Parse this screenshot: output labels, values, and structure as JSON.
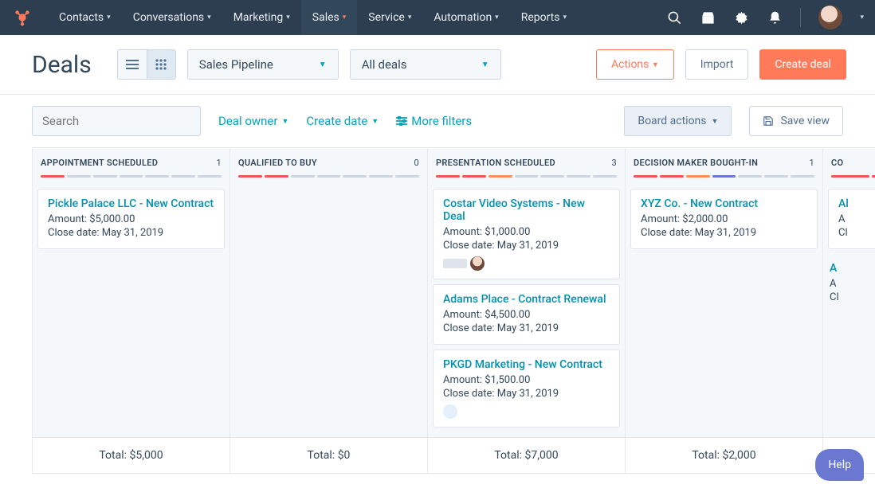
{
  "nav": {
    "items": [
      {
        "label": "Contacts"
      },
      {
        "label": "Conversations"
      },
      {
        "label": "Marketing"
      },
      {
        "label": "Sales",
        "active": true
      },
      {
        "label": "Service"
      },
      {
        "label": "Automation"
      },
      {
        "label": "Reports"
      }
    ]
  },
  "header": {
    "title": "Deals",
    "pipeline": "Sales Pipeline",
    "deals_filter": "All deals",
    "actions": "Actions",
    "import": "Import",
    "create": "Create deal"
  },
  "filters": {
    "search_placeholder": "Search",
    "deal_owner": "Deal owner",
    "create_date": "Create date",
    "more_filters": "More filters",
    "board_actions": "Board actions",
    "save_view": "Save view"
  },
  "columns": [
    {
      "title": "APPOINTMENT SCHEDULED",
      "count": "1",
      "cards": [
        {
          "title": "Pickle Palace LLC - New Contract",
          "amount_label": "Amount:",
          "amount": "$5,000.00",
          "close_label": "Close date:",
          "close": "May 31, 2019"
        }
      ],
      "total_label": "Total:",
      "total": "$5,000"
    },
    {
      "title": "QUALIFIED TO BUY",
      "count": "0",
      "cards": [],
      "total_label": "Total:",
      "total": "$0"
    },
    {
      "title": "PRESENTATION SCHEDULED",
      "count": "3",
      "cards": [
        {
          "title": "Costar Video Systems - New Deal",
          "amount_label": "Amount:",
          "amount": "$1,000.00",
          "close_label": "Close date:",
          "close": "May 31, 2019",
          "avatars": true
        },
        {
          "title": "Adams Place - Contract Renewal",
          "amount_label": "Amount:",
          "amount": "$4,500.00",
          "close_label": "Close date:",
          "close": "May 31, 2019"
        },
        {
          "title": "PKGD Marketing - New Contract",
          "amount_label": "Amount:",
          "amount": "$1,500.00",
          "close_label": "Close date:",
          "close": "May 31, 2019",
          "oneav": true
        }
      ],
      "total_label": "Total:",
      "total": "$7,000"
    },
    {
      "title": "DECISION MAKER BOUGHT-IN",
      "count": "1",
      "cards": [
        {
          "title": "XYZ Co. - New Contract",
          "amount_label": "Amount:",
          "amount": "$2,000.00",
          "close_label": "Close date:",
          "close": "May 31, 2019"
        }
      ],
      "total_label": "Total:",
      "total": "$2,000"
    },
    {
      "title": "CO",
      "count": "",
      "cards": [
        {
          "title": "Al",
          "amount_label": "A",
          "amount": "",
          "close_label": "Cl",
          "close": ""
        },
        {
          "title": "A",
          "amount_label": "A",
          "amount": "",
          "close_label": "Cl",
          "close": ""
        }
      ],
      "total_label": "",
      "total": ""
    }
  ],
  "help": "Help"
}
